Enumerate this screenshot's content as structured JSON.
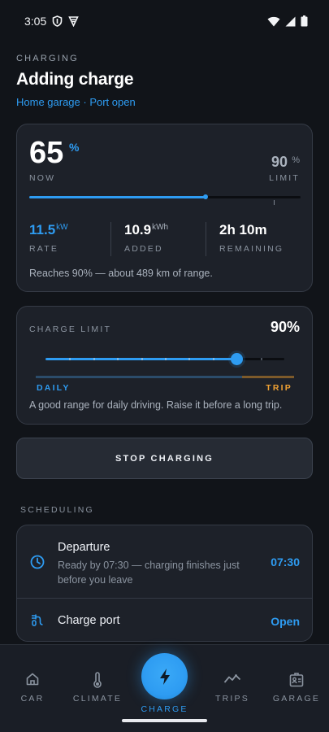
{
  "status_bar": {
    "time": "3:05",
    "icons": [
      "shield-icon",
      "vpn-icon",
      "wifi-icon",
      "signal-icon",
      "battery-icon"
    ]
  },
  "header": {
    "eyebrow": "CHARGING",
    "title": "Adding charge",
    "subtitle": "Home garage · Port open"
  },
  "charge_status": {
    "current_percent": "65",
    "current_unit": "%",
    "current_label": "NOW",
    "limit_percent": "90",
    "limit_unit": "%",
    "limit_label": "LIMIT",
    "progress": 0.65,
    "limit_fraction": 0.9,
    "stats": [
      {
        "value": "11.5",
        "unit": "kW",
        "label": "RATE"
      },
      {
        "value": "10.9",
        "unit": "kWh",
        "label": "ADDED"
      },
      {
        "value": "2h 10m",
        "unit": "",
        "label": "REMAINING"
      }
    ],
    "range_note": "Reaches 90% — about 489 km of range."
  },
  "charge_limit": {
    "label": "CHARGE LIMIT",
    "value": "90%",
    "slider_fraction": 0.8,
    "daily_label": "DAILY",
    "trip_label": "TRIP",
    "hint": "A good range for daily driving. Raise it before a long trip."
  },
  "actions": {
    "stop_label": "STOP CHARGING"
  },
  "scheduling": {
    "section_label": "SCHEDULING",
    "departure_title": "Departure",
    "departure_desc": "Ready by 07:30 — charging finishes just before you leave",
    "departure_time": "07:30",
    "port_title": "Charge port",
    "port_status": "Open"
  },
  "nav": {
    "items": [
      {
        "label": "CAR",
        "icon": "home-icon"
      },
      {
        "label": "CLIMATE",
        "icon": "thermometer-icon"
      },
      {
        "label": "CHARGE",
        "icon": "bolt-icon",
        "active": true
      },
      {
        "label": "TRIPS",
        "icon": "trend-icon"
      },
      {
        "label": "GARAGE",
        "icon": "garage-icon"
      }
    ]
  },
  "colors": {
    "accent": "#2e9cf2",
    "trip": "#f0a234",
    "background": "#111419",
    "card": "#1d2129"
  }
}
